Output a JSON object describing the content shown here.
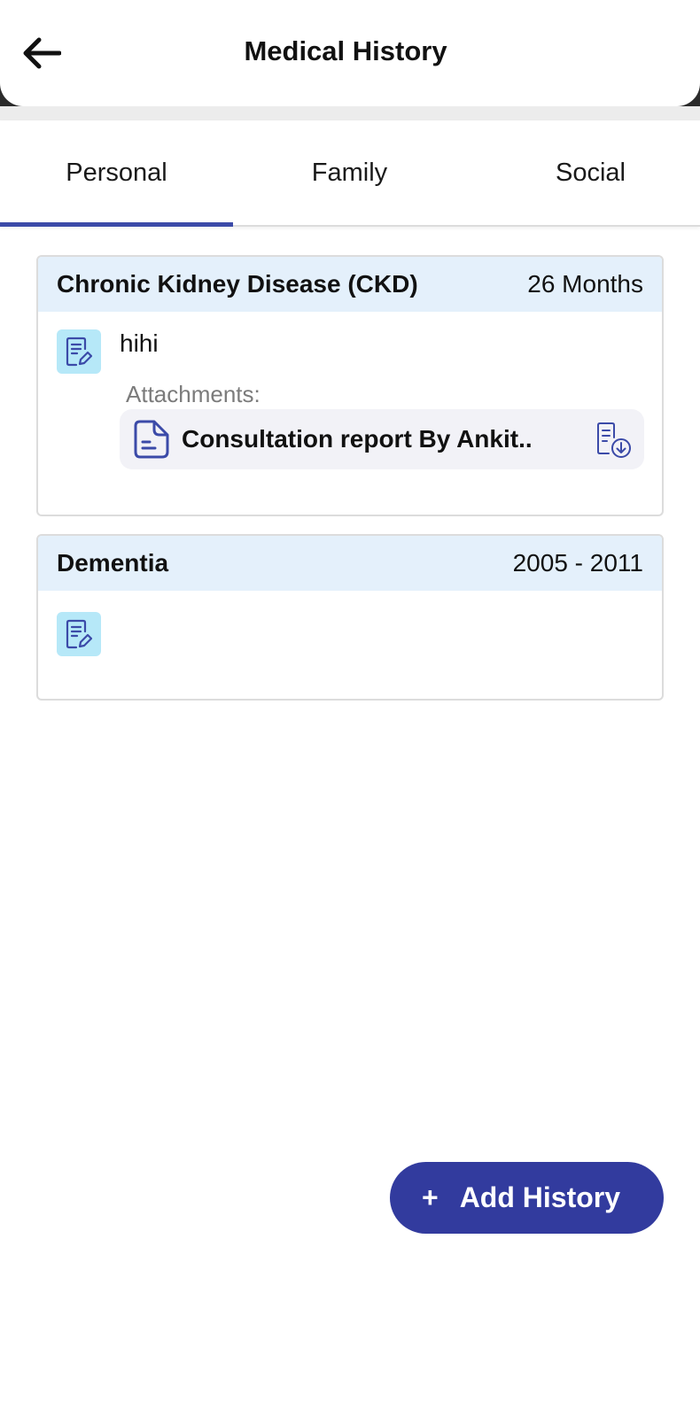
{
  "header": {
    "title": "Medical History"
  },
  "tabs": [
    {
      "label": "Personal",
      "active": true
    },
    {
      "label": "Family",
      "active": false
    },
    {
      "label": "Social",
      "active": false
    }
  ],
  "conditions": [
    {
      "name": "Chronic Kidney Disease (CKD)",
      "duration": "26 Months",
      "note": "hihi",
      "attachments_label": "Attachments:",
      "attachments": [
        {
          "name": "Consultation report By Ankit.."
        }
      ]
    },
    {
      "name": "Dementia",
      "duration": "2005 - 2011",
      "note": ""
    }
  ],
  "fab": {
    "plus": "+",
    "label": "Add History"
  },
  "icons": {
    "back": "arrow-left-icon",
    "edit": "edit-note-icon",
    "document": "document-icon",
    "download": "file-download-icon"
  },
  "colors": {
    "accent": "#323b9e",
    "tab_indicator": "#3b4aa8",
    "card_header_bg": "#e4f0fb",
    "edit_icon_bg": "#b6e8f8",
    "attachment_bg": "#f2f2f7"
  }
}
